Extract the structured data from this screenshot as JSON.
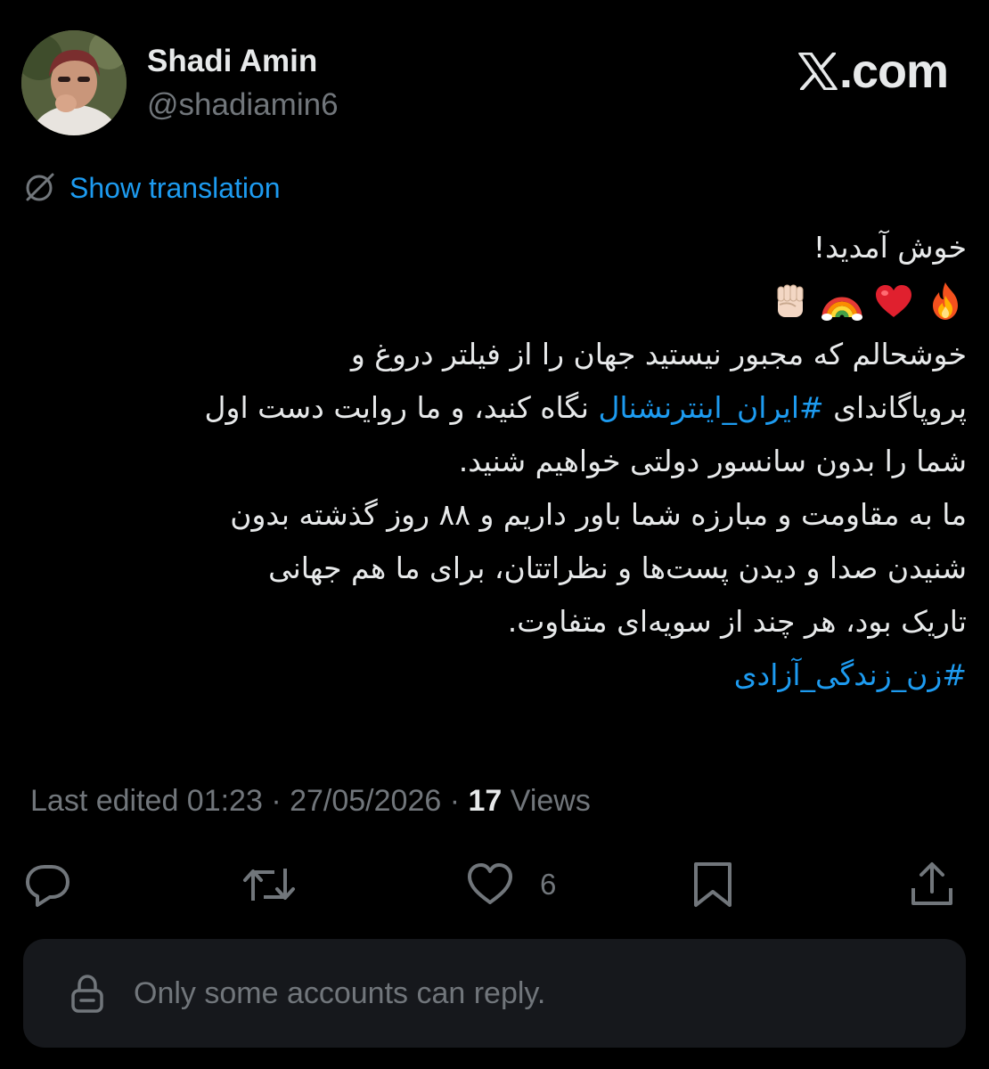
{
  "colors": {
    "background": "#000000",
    "text_primary": "#e7e9ea",
    "text_secondary": "#71767b",
    "accent": "#1d9bf0",
    "reply_bar_bg": "#16181c"
  },
  "author": {
    "display_name": "Shadi Amin",
    "handle": "@shadiamin6",
    "avatar_icon": "profile-photo"
  },
  "brand": {
    "logo_icon": "x-logo-icon",
    "domain_suffix": ".com"
  },
  "translation": {
    "icon": "globe-slash-icon",
    "label": "Show translation"
  },
  "tweet": {
    "line1": "خوش آمدید!",
    "emojis": [
      "fire-emoji",
      "heart-emoji",
      "rainbow-emoji",
      "raised-fist-emoji"
    ],
    "line2": "خوشحالم که مجبور نیستید جهان را از فیلتر دروغ و",
    "line3_before": "پروپاگاندای ",
    "line3_hashtag": "#ایران_اینترنشنال",
    "line3_after": " نگاه کنید، و ما روایت دست اول",
    "line4": "شما را بدون سانسور دولتی خواهیم شنید.",
    "line5": "ما به مقاومت و مبارزه شما باور داریم و ۸۸ روز گذشته بدون",
    "line6": "شنیدن صدا و دیدن پست‌ها و نظراتتان، برای ما هم جهانی",
    "line7": "تاریک بود، هر چند از سویه‌ای متفاوت.",
    "final_hashtag": "#زن_زندگی_آزادی"
  },
  "meta": {
    "edited_prefix": "Last edited 01:23 · 27/05/2026 · ",
    "views_count": "17",
    "views_label": " Views"
  },
  "actions": {
    "reply_icon": "reply-icon",
    "retweet_icon": "retweet-icon",
    "like_icon": "heart-icon",
    "like_count": "6",
    "bookmark_icon": "bookmark-icon",
    "share_icon": "share-icon"
  },
  "reply_restriction": {
    "icon": "lock-icon",
    "text": "Only some accounts can reply."
  }
}
